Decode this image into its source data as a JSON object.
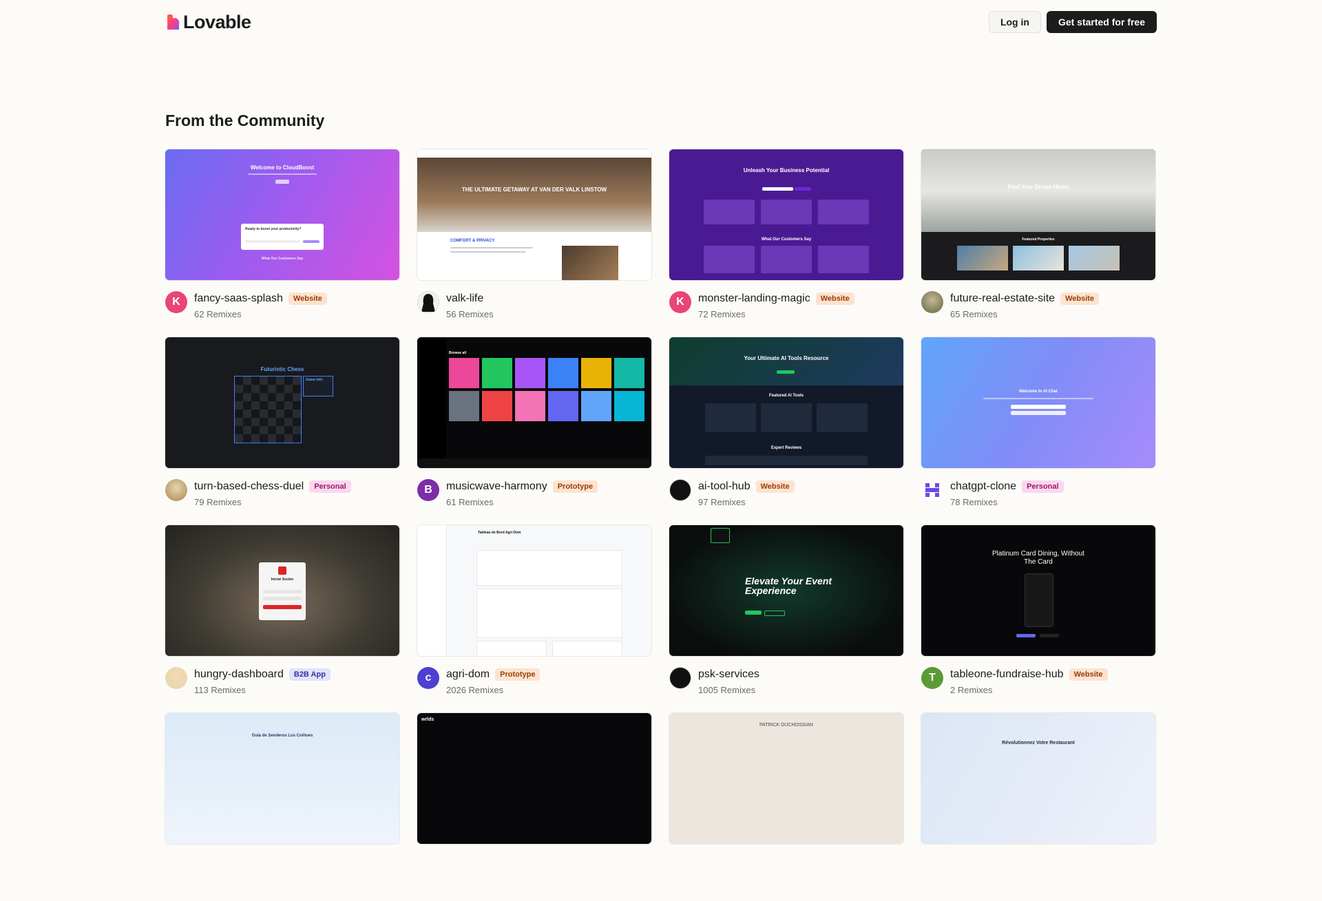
{
  "header": {
    "logo_text": "Lovable",
    "login_label": "Log in",
    "cta_label": "Get started for free"
  },
  "community": {
    "title": "From the Community",
    "cards": [
      {
        "name": "fancy-saas-splash",
        "badge": "Website",
        "remixes": "62 Remixes",
        "avatar_letter": "K",
        "avatar_color": "#e9457a",
        "thumb_title": "Welcome to CloudBoost",
        "thumb_sub": "Ready to boost your productivity?",
        "thumb_foot": "What Our Customers Say"
      },
      {
        "name": "valk-life",
        "badge": "",
        "remixes": "56 Remixes",
        "avatar_letter": "",
        "avatar_color": "#1c1c1c",
        "thumb_title": "THE ULTIMATE GETAWAY AT VAN DER VALK LINSTOW",
        "thumb_sub": "COMFORT & PRIVACY",
        "thumb_foot": ""
      },
      {
        "name": "monster-landing-magic",
        "badge": "Website",
        "remixes": "72 Remixes",
        "avatar_letter": "K",
        "avatar_color": "#e9457a",
        "thumb_title": "Unleash Your Business Potential",
        "thumb_sub": "What Our Customers Say",
        "thumb_foot": ""
      },
      {
        "name": "future-real-estate-site",
        "badge": "Website",
        "remixes": "65 Remixes",
        "avatar_letter": "",
        "avatar_color": "#5b6b3a",
        "thumb_title": "Find Your Dream Home",
        "thumb_sub": "Featured Properties",
        "thumb_foot": ""
      },
      {
        "name": "turn-based-chess-duel",
        "badge": "Personal",
        "remixes": "79 Remixes",
        "avatar_letter": "",
        "avatar_color": "#a8874a",
        "thumb_title": "Futuristic Chess",
        "thumb_sub": "Game Info",
        "thumb_foot": ""
      },
      {
        "name": "musicwave-harmony",
        "badge": "Prototype",
        "remixes": "61 Remixes",
        "avatar_letter": "B",
        "avatar_color": "#7b2fa8",
        "thumb_title": "Browse all",
        "thumb_sub": "",
        "thumb_foot": ""
      },
      {
        "name": "ai-tool-hub",
        "badge": "Website",
        "remixes": "97 Remixes",
        "avatar_letter": "",
        "avatar_color": "#111111",
        "thumb_title": "Your Ultimate AI Tools Resource",
        "thumb_sub": "Featured AI Tools",
        "thumb_foot": "Expert Reviews"
      },
      {
        "name": "chatgpt-clone",
        "badge": "Personal",
        "remixes": "78 Remixes",
        "avatar_letter": "",
        "avatar_color": "#6d4ae0",
        "thumb_title": "Welcome to AI Chat",
        "thumb_sub": "",
        "thumb_foot": ""
      },
      {
        "name": "hungry-dashboard",
        "badge": "B2B App",
        "remixes": "113 Remixes",
        "avatar_letter": "",
        "avatar_color": "#e5d7a8",
        "thumb_title": "Iniciar Sesión",
        "thumb_sub": "",
        "thumb_foot": ""
      },
      {
        "name": "agri-dom",
        "badge": "Prototype",
        "remixes": "2026 Remixes",
        "avatar_letter": "c",
        "avatar_color": "#4f3fd1",
        "thumb_title": "Tableau de Bord Agri Dom",
        "thumb_sub": "",
        "thumb_foot": ""
      },
      {
        "name": "psk-services",
        "badge": "",
        "remixes": "1005 Remixes",
        "avatar_letter": "",
        "avatar_color": "#111111",
        "thumb_title": "Elevate Your Event Experience",
        "thumb_sub": "",
        "thumb_foot": ""
      },
      {
        "name": "tableone-fundraise-hub",
        "badge": "Website",
        "remixes": "2 Remixes",
        "avatar_letter": "T",
        "avatar_color": "#5a9b35",
        "thumb_title": "Platinum Card Dining, Without The Card",
        "thumb_sub": "",
        "thumb_foot": ""
      }
    ],
    "partial_cards": [
      {
        "thumb_title": "Guía de Senderos Los Coihues"
      },
      {
        "thumb_title": "wrlds"
      },
      {
        "thumb_title": "PATRICK DUCHOSSIAN"
      },
      {
        "thumb_title": "Révolutionnez Votre Restaurant"
      }
    ]
  }
}
